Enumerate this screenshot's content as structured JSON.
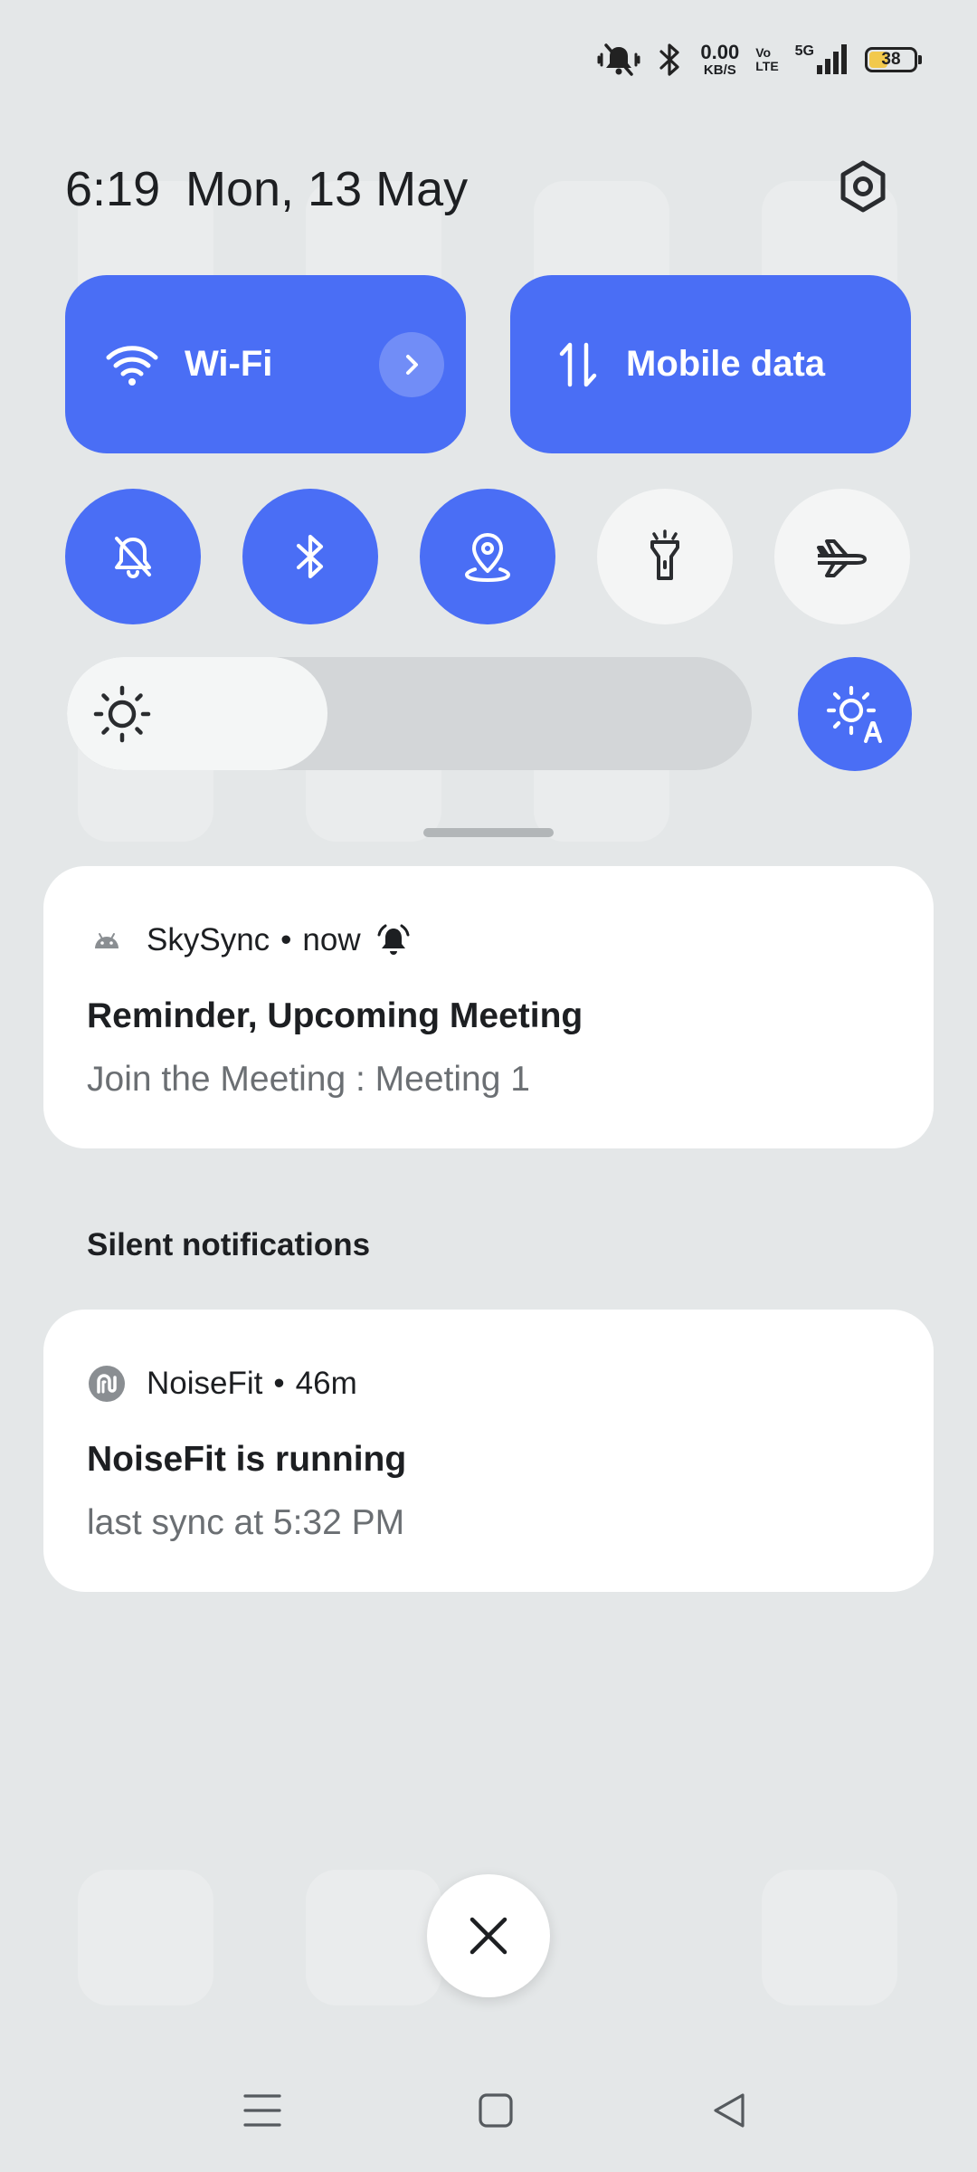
{
  "status_bar": {
    "net_speed_value": "0.00",
    "net_speed_unit": "KB/S",
    "volte_top": "Vo",
    "volte_bottom": "LTE",
    "network": "5G",
    "battery_level": "38",
    "battery_fraction": 0.38,
    "icons": [
      "mute-vibrate-icon",
      "bluetooth-icon",
      "signal-icon",
      "battery-icon"
    ]
  },
  "header": {
    "time": "6:19",
    "date": "Mon, 13 May"
  },
  "quick_tiles": [
    {
      "label": "Wi-Fi",
      "icon": "wifi-icon",
      "active": true
    },
    {
      "label": "Mobile data",
      "icon": "data-arrows-icon",
      "active": true
    }
  ],
  "toggles": [
    {
      "icon": "bell-off-icon",
      "active": true
    },
    {
      "icon": "bluetooth-icon",
      "active": true
    },
    {
      "icon": "location-icon",
      "active": true
    },
    {
      "icon": "flashlight-icon",
      "active": false
    },
    {
      "icon": "airplane-icon",
      "active": false
    }
  ],
  "brightness": {
    "level": 0.38,
    "auto": true
  },
  "notifications": [
    {
      "app": "SkySync",
      "separator": "•",
      "time": "now",
      "title": "Reminder, Upcoming Meeting",
      "text": "Join the Meeting : Meeting 1"
    }
  ],
  "silent_section": {
    "label": "Silent notifications",
    "items": [
      {
        "app": "NoiseFit",
        "separator": "•",
        "time": "46m",
        "title": "NoiseFit is running",
        "text": "last sync at 5:32 PM"
      }
    ]
  },
  "colors": {
    "accent": "#4a6ef5",
    "background": "#e4e7e8",
    "card": "#ffffff",
    "battery": "#f2c94c"
  }
}
